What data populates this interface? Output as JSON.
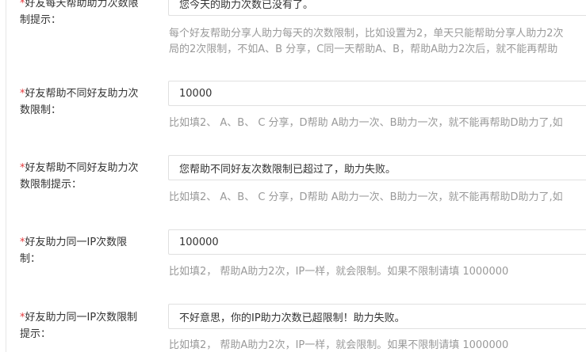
{
  "fields": [
    {
      "label_star": "*",
      "label_text": "好友每天帮助助力次数限\n制提示：",
      "value": "您今天的助力次数已没有了。",
      "help": [
        "每个好友帮助分享人助力每天的次数限制，比如设置为2，单天只能帮助分享人助力2次",
        "局的2次限制，不如A、B 分享，C同一天帮助A、B，帮助A助力2次后，就不能再帮助"
      ]
    },
    {
      "label_star": "*",
      "label_text": "好友帮助不同好友助力次\n数限制：",
      "value": "10000",
      "help": [
        "比如填2、 A、B、 C 分享，D帮助 A助力一次、B助力一次，就不能再帮助D助力了,如"
      ]
    },
    {
      "label_star": "*",
      "label_text": "好友帮助不同好友助力次\n数限制提示：",
      "value": "您帮助不同好友次数限制已超过了，助力失败。",
      "help": [
        "比如填2、 A、B、 C 分享，D帮助 A助力一次、B助力一次，就不能再帮助D助力了,如"
      ]
    },
    {
      "label_star": "*",
      "label_text": "好友助力同一IP次数限\n制：",
      "value": "100000",
      "help": [
        "比如填2， 帮助A助力2次，IP一样，就会限制。如果不限制请填 1000000"
      ]
    },
    {
      "label_star": "*",
      "label_text": "好友助力同一IP次数限制\n提示：",
      "value": "不好意思，你的IP助力次数已超限制！助力失败。",
      "help": [
        "比如填2， 帮助A助力2次，IP一样，就会限制。如果不限制请填 1000000"
      ]
    }
  ]
}
